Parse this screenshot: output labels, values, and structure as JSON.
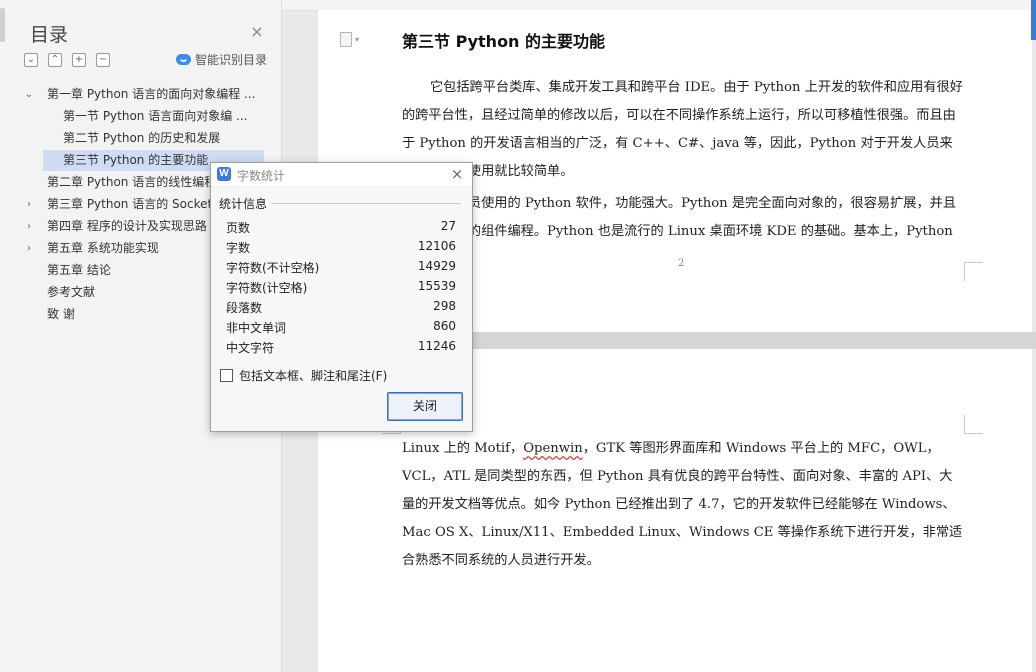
{
  "nav": {
    "title": "目录",
    "tools": [
      {
        "name": "collapse-all",
        "glyph": "⌄"
      },
      {
        "name": "expand-all",
        "glyph": "⌃"
      },
      {
        "name": "add",
        "glyph": "+"
      },
      {
        "name": "remove",
        "glyph": "−"
      }
    ],
    "smart_toc_label": "智能识别目录",
    "items": [
      {
        "label": "第一章  Python 语言的面向对象编程 ...",
        "level": 1,
        "arrow": "expanded"
      },
      {
        "label": "第一节  Python 语言面向对象编 ...",
        "level": 2,
        "arrow": "none"
      },
      {
        "label": "第二节  Python 的历史和发展",
        "level": 2,
        "arrow": "none"
      },
      {
        "label": "第三节  Python 的主要功能",
        "level": 2,
        "arrow": "none",
        "active": true
      },
      {
        "label": "第二章  Python 语言的线性编程",
        "level": 1,
        "arrow": "none"
      },
      {
        "label": "第三章  Python 语言的 Socket",
        "level": 1,
        "arrow": "collapsed"
      },
      {
        "label": "第四章  程序的设计及实现思路",
        "level": 1,
        "arrow": "collapsed"
      },
      {
        "label": "第五章  系统功能实现",
        "level": 1,
        "arrow": "collapsed"
      },
      {
        "label": "第五章  结论",
        "level": 1,
        "arrow": "none"
      },
      {
        "label": "参考文献",
        "level": 1,
        "arrow": "none"
      },
      {
        "label": "致    谢",
        "level": 1,
        "arrow": "none"
      }
    ]
  },
  "document": {
    "heading": "第三节  Python 的主要功能",
    "page1_para1": "它包括跨平台类库、集成开发工具和跨平台 IDE。由于 Python 上开发的软件和应用有很好的跨平台性，且经过简单的修改以后，可以在不同操作系统上运行，所以可移植性很强。而且由于 Python 的开发语言相当的广泛，有 C++、C#、java 等，因此，Python 对于开发人员来说，学习和使用就比较简单。",
    "page1_para2": "目前开发人员使用的 Python 软件，功能强大。Python 是完全面向对象的，很容易扩展，并且允许跨平台的组件编程。Python 也是流行的 Linux 桌面环境 KDE 的基础。基本上，Python 同",
    "page_number": "2",
    "page2_para_lead": "Linux 上的 Motif，",
    "page2_para_squiggle": "Openwin",
    "page2_para_rest": "，GTK 等图形界面库和 Windows 平台上的 MFC，OWL，VCL，ATL 是同类型的东西，但 Python 具有优良的跨平台特性、面向对象、丰富的 API、大量的开发文档等优点。如今 Python 已经推出到了 4.7，它的开发软件已经能够在 Windows、Mac OS X、Linux/X11、Embedded Linux、Windows CE 等操作系统下进行开发，非常适合熟悉不同系统的人员进行开发。"
  },
  "dialog": {
    "title": "字数统计",
    "logo_letter": "W",
    "group_label": "统计信息",
    "stats": [
      {
        "label": "页数",
        "value": "27"
      },
      {
        "label": "字数",
        "value": "12106"
      },
      {
        "label": "字符数(不计空格)",
        "value": "14929"
      },
      {
        "label": "字符数(计空格)",
        "value": "15539"
      },
      {
        "label": "段落数",
        "value": "298"
      },
      {
        "label": "非中文单词",
        "value": "860"
      },
      {
        "label": "中文字符",
        "value": "11246"
      }
    ],
    "checkbox_label": "包括文本框、脚注和尾注(F)",
    "checkbox_checked": false,
    "close_button": "关闭"
  },
  "colors": {
    "accent": "#3b7be0",
    "nav_active": "#cfdcf4"
  }
}
